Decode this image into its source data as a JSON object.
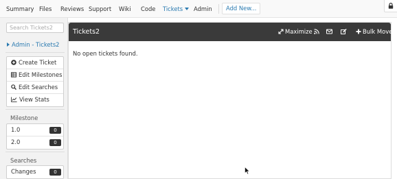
{
  "nav": {
    "items": [
      {
        "label": "Summary",
        "active": false
      },
      {
        "label": "Files",
        "active": false
      },
      {
        "label": "Reviews",
        "active": false
      },
      {
        "label": "Support",
        "active": false
      },
      {
        "label": "Wiki",
        "active": false
      },
      {
        "label": "Code",
        "active": false
      },
      {
        "label": "Tickets",
        "active": true,
        "dropdown": true
      },
      {
        "label": "Admin",
        "active": false
      }
    ],
    "add_new_label": "Add New...",
    "lock_icon": "lock-icon"
  },
  "sidebar": {
    "search_placeholder": "Search Tickets2",
    "breadcrumb": "Admin - Tickets2",
    "actions": [
      {
        "label": "Create Ticket",
        "icon": "plus-circle-icon"
      },
      {
        "label": "Edit Milestones",
        "icon": "table-icon"
      },
      {
        "label": "Edit Searches",
        "icon": "search-icon"
      },
      {
        "label": "View Stats",
        "icon": "line-chart-icon"
      }
    ],
    "milestone_title": "Milestone",
    "milestones": [
      {
        "label": "1.0",
        "count": "0"
      },
      {
        "label": "2.0",
        "count": "0"
      }
    ],
    "searches_title": "Searches",
    "searches": [
      {
        "label": "Changes",
        "count": "0"
      }
    ]
  },
  "panel": {
    "title": "Tickets2",
    "maximize_label": "Maximize",
    "bulk_move_label": "Bulk Move",
    "empty_message": "No open tickets found."
  },
  "colors": {
    "link": "#2a7ab0",
    "header_bg": "#3a3a3a",
    "badge_bg": "#333333"
  }
}
